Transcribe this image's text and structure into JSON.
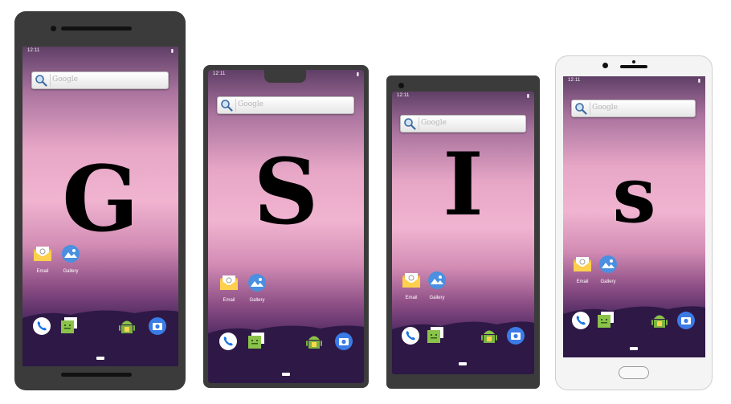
{
  "phones": [
    {
      "time": "12:11",
      "search_placeholder": "Google",
      "letter": "G",
      "apps": [
        "Email",
        "Gallery"
      ]
    },
    {
      "time": "12:11",
      "search_placeholder": "Google",
      "letter": "S",
      "apps": [
        "Email",
        "Gallery"
      ]
    },
    {
      "time": "12:11",
      "search_placeholder": "Google",
      "letter": "I",
      "apps": [
        "Email",
        "Gallery"
      ]
    },
    {
      "time": "12:11",
      "search_placeholder": "Google",
      "letter": "s",
      "apps": [
        "Email",
        "Gallery"
      ]
    }
  ],
  "icons": [
    "search-icon",
    "email-icon",
    "gallery-icon",
    "phone-icon",
    "messaging-icon",
    "android-icon",
    "camera-icon"
  ],
  "colors": {
    "wallpaper_pink": "#f0b4d0",
    "wallpaper_dark": "#24123c",
    "dark_bezel": "#3b3b3b",
    "light_bezel": "#f4f4f4"
  }
}
